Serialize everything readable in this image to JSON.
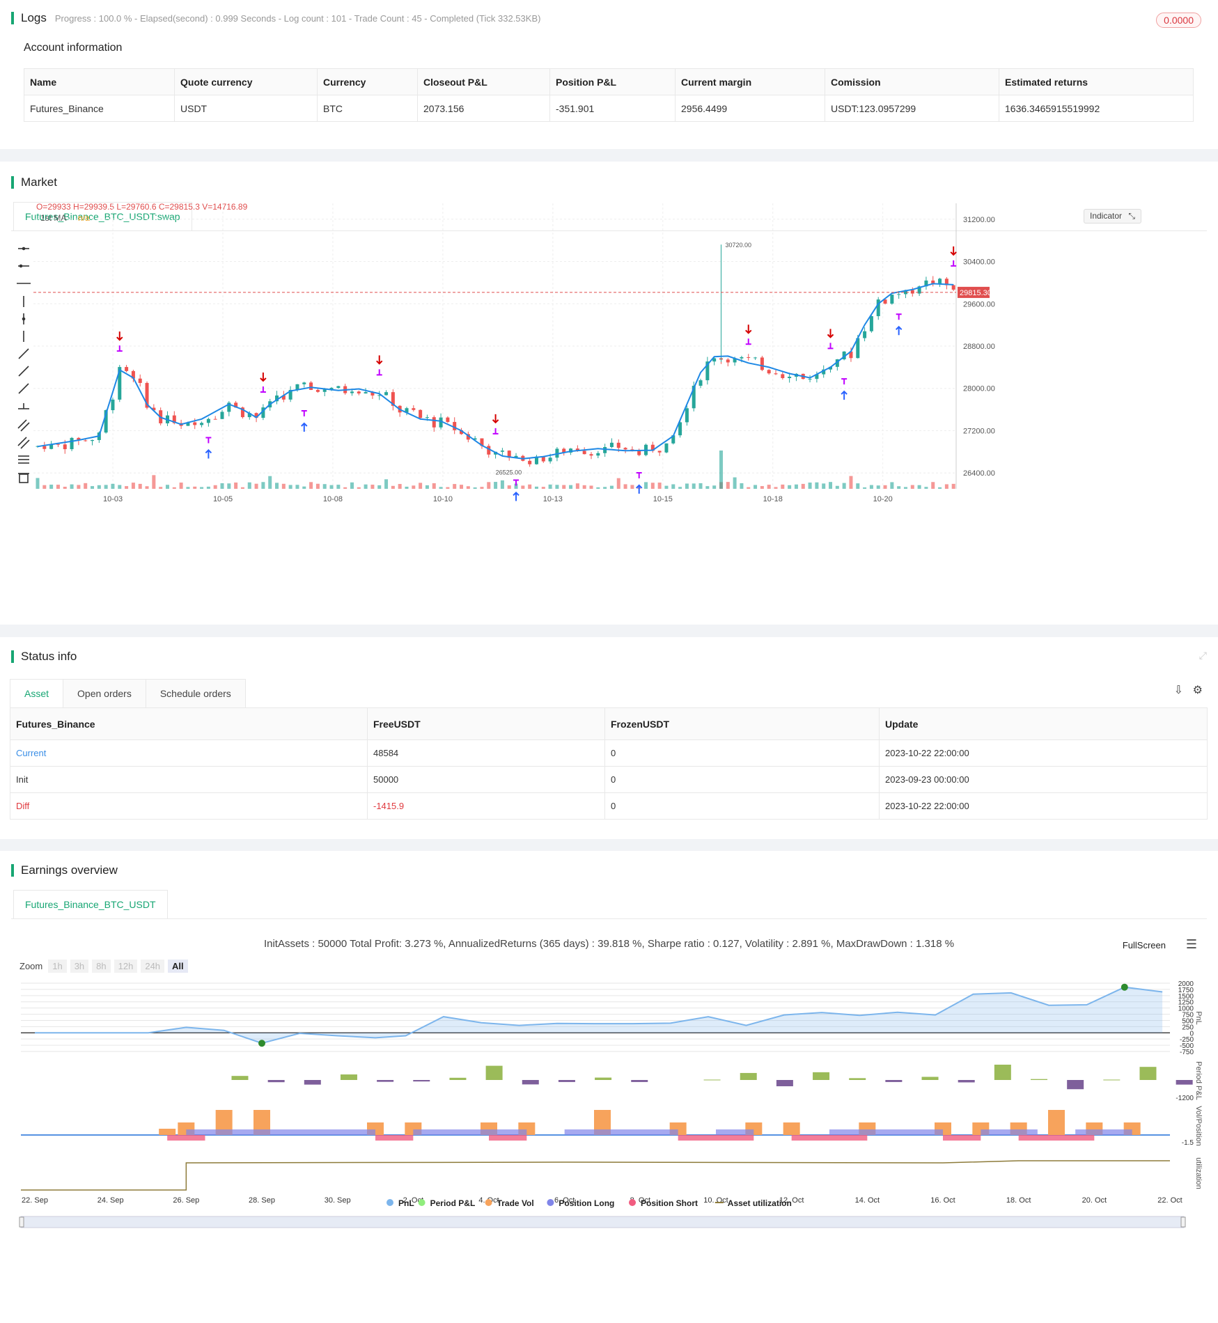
{
  "logs": {
    "title": "Logs",
    "summary": "Progress : 100.0 % - Elapsed(second) : 0.999  Seconds - Log count : 101 - Trade Count : 45 - Completed (Tick 332.53KB)",
    "badge": "0.0000",
    "account_title": "Account information",
    "account_headers": [
      "Name",
      "Quote currency",
      "Currency",
      "Closeout P&L",
      "Position P&L",
      "Current margin",
      "Comission",
      "Estimated returns"
    ],
    "account_row": [
      "Futures_Binance",
      "USDT",
      "BTC",
      "2073.156",
      "-351.901",
      "2956.4499",
      "USDT:123.0957299",
      "1636.3465915519992"
    ]
  },
  "market": {
    "title": "Market",
    "tab": "Futures_Binance_BTC_USDT:swap",
    "ohlc": "O=29933 H=29939.5 L=29760.6 C=29815.3 V=14716.89",
    "ma_label": "1st MA",
    "ma_value": "n/a",
    "indicator_btn": "Indicator",
    "price_tag": "29815.30",
    "high_label": "30720.00",
    "low_label": "26525.00",
    "colors": {
      "up": "#26a69a",
      "down": "#ef5350",
      "ma": "#1e88e5",
      "long": "#2962ff",
      "short": "#d50000",
      "close": "#c000ff"
    }
  },
  "status": {
    "title": "Status info",
    "tabs": [
      "Asset",
      "Open orders",
      "Schedule orders"
    ],
    "headers": [
      "Futures_Binance",
      "FreeUSDT",
      "FrozenUSDT",
      "Update"
    ],
    "rows": [
      [
        "Current",
        "48584",
        "0",
        "2023-10-22 22:00:00"
      ],
      [
        "Init",
        "50000",
        "0",
        "2023-09-23 00:00:00"
      ],
      [
        "Diff",
        "-1415.9",
        "0",
        "2023-10-22 22:00:00"
      ]
    ]
  },
  "earnings": {
    "title": "Earnings overview",
    "tab": "Futures_Binance_BTC_USDT",
    "stats": "InitAssets : 50000 Total Profit: 3.273 %, AnnualizedReturns (365 days) : 39.818 %, Sharpe ratio : 0.127, Volatility : 2.891 %, MaxDrawDown : 1.318 %",
    "fullscreen": "FullScreen",
    "zoom_label": "Zoom",
    "zoom_buttons": [
      "1h",
      "3h",
      "8h",
      "12h",
      "24h",
      "All"
    ],
    "legend": [
      "PnL",
      "Period P&L",
      "Trade Vol",
      "Position Long",
      "Position Short",
      "Asset utilization"
    ],
    "legend_colors": [
      "#7cb5ec",
      "#90ed7d",
      "#f7a35c",
      "#8085e9",
      "#f15c80",
      "#8d7b3a"
    ],
    "pnl_ticks": [
      "2000",
      "1750",
      "1500",
      "1250",
      "1000",
      "750",
      "500",
      "250",
      "0",
      "-250",
      "-500",
      "-750"
    ],
    "period_tick": "-1200",
    "vol_tick": "-1.5",
    "axis_titles": [
      "PnL",
      "Period P&L",
      "Vol/Position",
      "utilization"
    ],
    "x_labels": [
      "22. Sep",
      "24. Sep",
      "26. Sep",
      "28. Sep",
      "30. Sep",
      "2. Oct",
      "4. Oct",
      "6. Oct",
      "8. Oct",
      "10. Oct",
      "12. Oct",
      "14. Oct",
      "16. Oct",
      "18. Oct",
      "20. Oct",
      "22. Oct"
    ]
  },
  "chart_data": [
    {
      "type": "candlestick",
      "title": "Futures_Binance_BTC_USDT:swap",
      "x_ticks": [
        "10-03",
        "10-05",
        "10-08",
        "10-10",
        "10-13",
        "10-15",
        "10-18",
        "10-20"
      ],
      "y_ticks": [
        "31200.00",
        "30400.00",
        "29600.00",
        "28800.00",
        "28000.00",
        "27200.00",
        "26400.00"
      ],
      "ylim": [
        26100,
        31500
      ],
      "ma_series": [
        [
          0,
          26900
        ],
        [
          6,
          27020
        ],
        [
          9,
          27100
        ],
        [
          12,
          28350
        ],
        [
          14,
          28200
        ],
        [
          16,
          27700
        ],
        [
          18,
          27450
        ],
        [
          21,
          27320
        ],
        [
          24,
          27420
        ],
        [
          26,
          27560
        ],
        [
          28,
          27700
        ],
        [
          30,
          27600
        ],
        [
          32,
          27450
        ],
        [
          34,
          27700
        ],
        [
          37,
          27950
        ],
        [
          40,
          28020
        ],
        [
          44,
          27960
        ],
        [
          47,
          27990
        ],
        [
          50,
          27900
        ],
        [
          53,
          27600
        ],
        [
          56,
          27420
        ],
        [
          59,
          27380
        ],
        [
          62,
          27200
        ],
        [
          65,
          26920
        ],
        [
          68,
          26720
        ],
        [
          71,
          26670
        ],
        [
          74,
          26710
        ],
        [
          78,
          26810
        ],
        [
          82,
          26860
        ],
        [
          86,
          26820
        ],
        [
          90,
          26830
        ],
        [
          93,
          27100
        ],
        [
          95,
          27700
        ],
        [
          97,
          28300
        ],
        [
          99,
          28600
        ],
        [
          101,
          28610
        ],
        [
          104,
          28480
        ],
        [
          107,
          28400
        ],
        [
          110,
          28280
        ],
        [
          113,
          28200
        ],
        [
          116,
          28400
        ],
        [
          119,
          28700
        ],
        [
          121,
          29200
        ],
        [
          123,
          29600
        ],
        [
          125,
          29800
        ],
        [
          128,
          29870
        ],
        [
          131,
          29980
        ],
        [
          134,
          29960
        ]
      ]
    },
    {
      "type": "line",
      "title": "PnL",
      "x_labels": [
        "22. Sep",
        "24. Sep",
        "26. Sep",
        "28. Sep",
        "30. Sep",
        "2. Oct",
        "4. Oct",
        "6. Oct",
        "8. Oct",
        "10. Oct",
        "12. Oct",
        "14. Oct",
        "16. Oct",
        "18. Oct",
        "20. Oct",
        "22. Oct"
      ],
      "ylim": [
        -750,
        2000
      ],
      "points": [
        [
          22.0,
          0
        ],
        [
          25.0,
          0
        ],
        [
          26.0,
          220
        ],
        [
          27.0,
          100
        ],
        [
          28.0,
          -420
        ],
        [
          29.0,
          -20
        ],
        [
          30.0,
          -120
        ],
        [
          31.0,
          -200
        ],
        [
          31.8,
          -120
        ],
        [
          32.8,
          650
        ],
        [
          33.8,
          410
        ],
        [
          34.8,
          300
        ],
        [
          35.8,
          380
        ],
        [
          36.8,
          370
        ],
        [
          37.8,
          370
        ],
        [
          38.8,
          390
        ],
        [
          39.8,
          650
        ],
        [
          40.8,
          300
        ],
        [
          41.8,
          720
        ],
        [
          42.8,
          820
        ],
        [
          43.8,
          700
        ],
        [
          44.8,
          830
        ],
        [
          45.8,
          720
        ],
        [
          46.8,
          1560
        ],
        [
          47.8,
          1610
        ],
        [
          48.8,
          1110
        ],
        [
          49.8,
          1130
        ],
        [
          50.8,
          1840
        ],
        [
          51.8,
          1650
        ]
      ]
    },
    {
      "type": "bar",
      "title": "Period P&L",
      "values": [
        0,
        0,
        220,
        -120,
        -250,
        300,
        -100,
        -80,
        120,
        770,
        -240,
        -110,
        130,
        -110,
        0,
        20,
        380,
        -340,
        420,
        100,
        -110,
        170,
        -130,
        830,
        50,
        -500,
        20,
        710,
        -250
      ],
      "colors": {
        "positive": "#9bbb59",
        "negative": "#7e5f9b"
      }
    }
  ]
}
